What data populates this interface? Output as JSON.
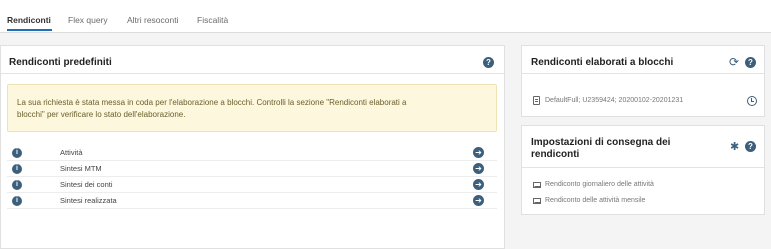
{
  "tabs": [
    {
      "label": "Rendiconti",
      "active": true
    },
    {
      "label": "Flex query",
      "active": false
    },
    {
      "label": "Altri resoconti",
      "active": false
    },
    {
      "label": "Fiscalità",
      "active": false
    }
  ],
  "predefined": {
    "title": "Rendiconti predefiniti",
    "alert_line1": "La sua richiesta è stata messa in coda per l'elaborazione a blocchi. Controlli la sezione \"Rendiconti elaborati a",
    "alert_line2": "blocchi\" per verificare lo stato dell'elaborazione.",
    "rows": [
      {
        "label": "Attività"
      },
      {
        "label": "Sintesi MTM"
      },
      {
        "label": "Sintesi dei conti"
      },
      {
        "label": "Sintesi realizzata"
      }
    ]
  },
  "batch": {
    "title": "Rendiconti elaborati a blocchi",
    "entry": "DefaultFull; U2359424; 20200102-20201231"
  },
  "delivery": {
    "title_line1": "Impostazioni di consegna dei",
    "title_line2": "rendiconti",
    "items": [
      {
        "label": "Rendiconto giornaliero delle attività"
      },
      {
        "label": "Rendiconto delle attività mensile"
      }
    ]
  },
  "icons": {
    "help": "?",
    "info": "i",
    "arrow": "➔",
    "refresh": "⟳",
    "gear": "✱"
  },
  "colors": {
    "accent": "#1f6fb5",
    "icon": "#3b5f7d",
    "alert_bg": "#fcf7dd"
  }
}
